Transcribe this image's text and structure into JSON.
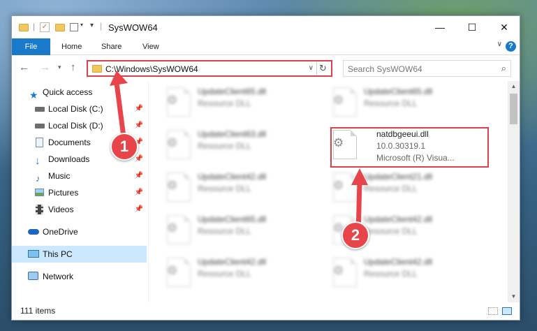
{
  "window": {
    "title": "SysWOW64",
    "minimize": "—",
    "maximize": "☐",
    "close": "✕"
  },
  "ribbon": {
    "tabs": [
      "File",
      "Home",
      "Share",
      "View"
    ],
    "help": "?"
  },
  "address": {
    "path": "C:\\Windows\\SysWOW64",
    "refresh_icon": "refresh-icon"
  },
  "search": {
    "placeholder": "Search SysWOW64"
  },
  "nav": {
    "items": [
      {
        "label": "Quick access",
        "icon": "star-icon"
      },
      {
        "label": "Local Disk (C:)",
        "icon": "drive-icon",
        "pinned": true
      },
      {
        "label": "Local Disk (D:)",
        "icon": "drive-icon",
        "pinned": true
      },
      {
        "label": "Documents",
        "icon": "documents-icon",
        "pinned": true
      },
      {
        "label": "Downloads",
        "icon": "download-icon",
        "pinned": true
      },
      {
        "label": "Music",
        "icon": "music-icon",
        "pinned": true
      },
      {
        "label": "Pictures",
        "icon": "pictures-icon",
        "pinned": true
      },
      {
        "label": "Videos",
        "icon": "videos-icon",
        "pinned": true
      },
      {
        "label": "OneDrive",
        "icon": "cloud-icon"
      },
      {
        "label": "This PC",
        "icon": "computer-icon",
        "selected": true
      },
      {
        "label": "Network",
        "icon": "network-icon"
      }
    ]
  },
  "files": [
    {
      "name": "UpdateClient65.dll",
      "desc": "Resource DLL",
      "blurred": true
    },
    {
      "name": "UpdateClient65.dll",
      "desc": "Resource DLL",
      "blurred": true
    },
    {
      "name": "UpdateClient63.dll",
      "desc": "Resource DLL",
      "blurred": true
    },
    {
      "name": "natdbgeeui.dll",
      "desc": "10.0.30319.1",
      "desc2": "Microsoft (R) Visua...",
      "blurred": false
    },
    {
      "name": "UpdateClient42.dll",
      "desc": "Resource DLL",
      "blurred": true
    },
    {
      "name": "UpdateClient21.dll",
      "desc": "Resource DLL",
      "blurred": true
    },
    {
      "name": "UpdateClient65.dll",
      "desc": "Resource DLL",
      "blurred": true
    },
    {
      "name": "UpdateClient42.dll",
      "desc": "Resource DLL",
      "blurred": true
    },
    {
      "name": "UpdateClient42.dll",
      "desc": "Resource DLL",
      "blurred": true
    },
    {
      "name": "UpdateClient42.dll",
      "desc": "Resource DLL",
      "blurred": true
    }
  ],
  "status": {
    "item_count": "111 items"
  },
  "annotations": {
    "step1": "1",
    "step2": "2",
    "color": "#e8454a"
  }
}
